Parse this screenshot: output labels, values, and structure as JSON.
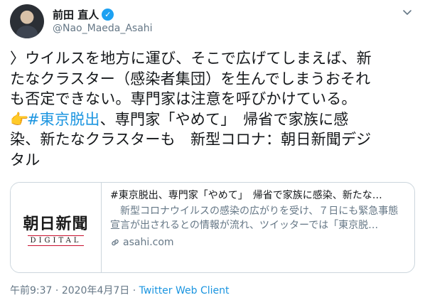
{
  "author": {
    "display_name": "前田 直人",
    "handle": "@Nao_Maeda_Asahi",
    "verified": true
  },
  "tweet": {
    "lines": [
      "〉ウイルスを地方に運び、そこで広げてしまえば、新",
      "たなクラスター（感染者集団）を生んでしまうおそれ",
      "も否定できない。専門家は注意を呼びかけている。"
    ],
    "emoji": "👉",
    "hashtag": "#東京脱出",
    "line4_rest": "、専門家「やめて」　帰省で家族に感",
    "line5": "染、新たなクラスターも　新型コロナ：朝日新聞デジ",
    "line6": "タル"
  },
  "card": {
    "logo_main": "朝日新聞",
    "logo_sub": "DIGITAL",
    "title": "#東京脱出、専門家「やめて」　帰省で家族に感染、新たな…",
    "description": "　新型コロナウイルスの感染の広がりを受け、７日にも緊急事態宣言が出されるとの情報が流れ、ツイッターでは「東京脱…",
    "domain": "asahi.com"
  },
  "meta": {
    "time": "午前9:37",
    "separator1": " · ",
    "date": "2020年4月7日",
    "separator2": " · ",
    "source": "Twitter Web Client"
  },
  "colors": {
    "link": "#1b95e0",
    "verified": "#1da1f2",
    "secondary_text": "#657786",
    "border": "#ccd6dd"
  }
}
